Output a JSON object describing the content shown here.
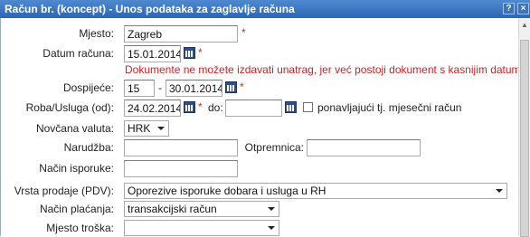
{
  "window": {
    "title": "Račun br. (koncept) - Unos podataka za zaglavlje računa",
    "help_label": "?",
    "close_label": "×"
  },
  "form": {
    "mjesto": {
      "label": "Mjesto:",
      "value": "Zagreb"
    },
    "datum_racuna": {
      "label": "Datum računa:",
      "value": "15.01.2014"
    },
    "warning": "Dokumente ne možete izdavati unatrag, jer već postoji dokument s kasnijim datumom.",
    "dospijece": {
      "label": "Dospijeće:",
      "days": "15",
      "separator": "-",
      "date": "30.01.2014"
    },
    "roba_usluga": {
      "label": "Roba/Usluga (od):",
      "value": "24.02.2014",
      "do_label": "do:",
      "do_value": "",
      "recurring_label": "ponavljajući tj. mjesečni račun",
      "recurring_checked": false
    },
    "valuta": {
      "label": "Novčana valuta:",
      "value": "HRK"
    },
    "narudzba": {
      "label": "Narudžba:",
      "value": ""
    },
    "otpremnica": {
      "label": "Otpremnica:",
      "value": ""
    },
    "nacin_isporuke": {
      "label": "Način isporuke:",
      "value": ""
    },
    "vrsta_prodaje": {
      "label": "Vrsta prodaje (PDV):",
      "value": "Oporezive isporuke dobara i usluga u RH"
    },
    "nacin_placanja": {
      "label": "Način plaćanja:",
      "value": "transakcijski račun"
    },
    "mjesto_troska": {
      "label": "Mjesto troška:",
      "value": ""
    },
    "required_mark": "*"
  },
  "colors": {
    "titlebar": "#2d66b3",
    "required": "#e02020",
    "warning": "#d42020"
  }
}
